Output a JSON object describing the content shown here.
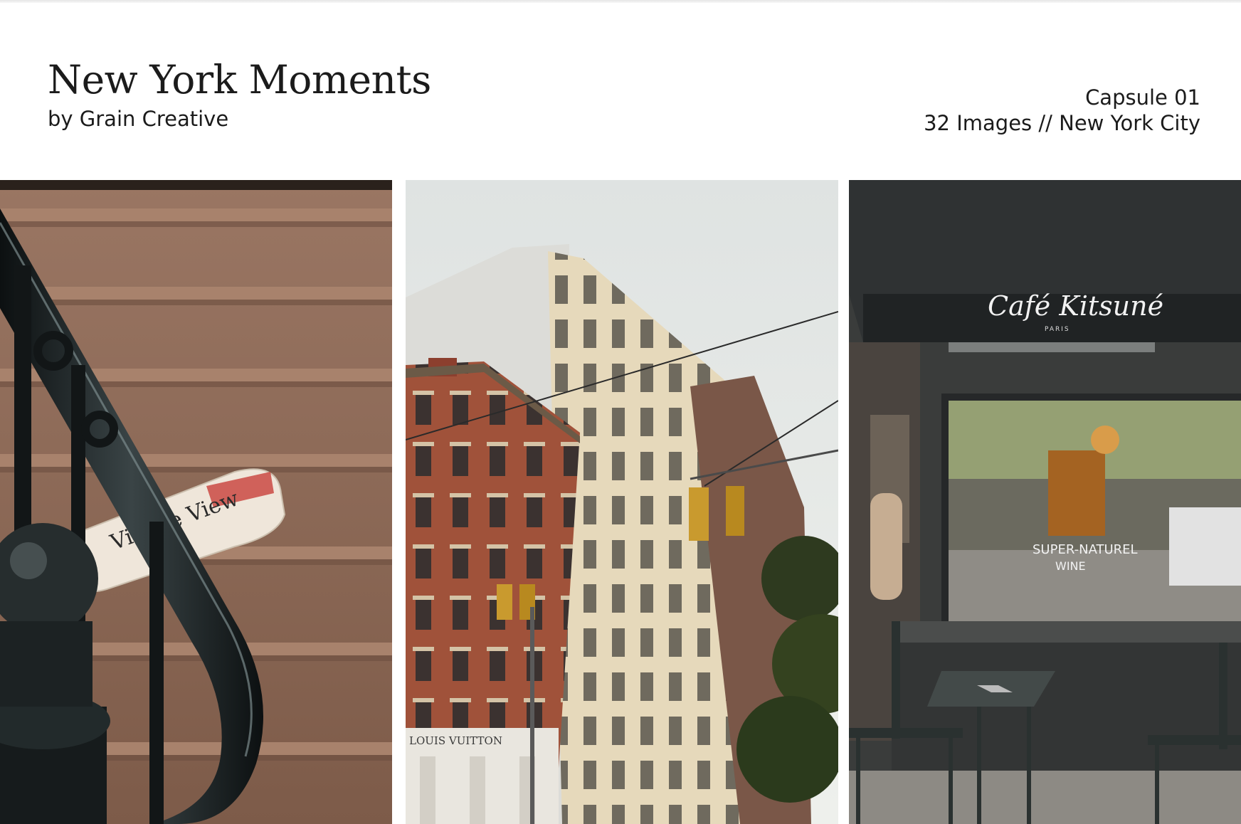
{
  "header": {
    "title": "New York Moments",
    "subtitle": "by Grain Creative",
    "capsule": "Capsule 01",
    "details": "32 Images // New York City"
  },
  "photos": [
    {
      "subject": "brownstone stoop with iron railing and folded newspaper",
      "newspaper_text": "Village View"
    },
    {
      "subject": "soho cast-iron buildings with traffic lights",
      "storefront_text": "LOUIS VUITTON"
    },
    {
      "subject": "cafe storefront with awning and bistro tables",
      "awning_text": "Café Kitsuné",
      "awning_subtext": "PARIS",
      "window_text": "SUPER-NATUREL",
      "window_text_2": "WINE"
    }
  ],
  "colors": {
    "stone": "#8a6a57",
    "brick": "#a0523a",
    "awning": "#2c2f2f",
    "railing": "#15191a"
  }
}
